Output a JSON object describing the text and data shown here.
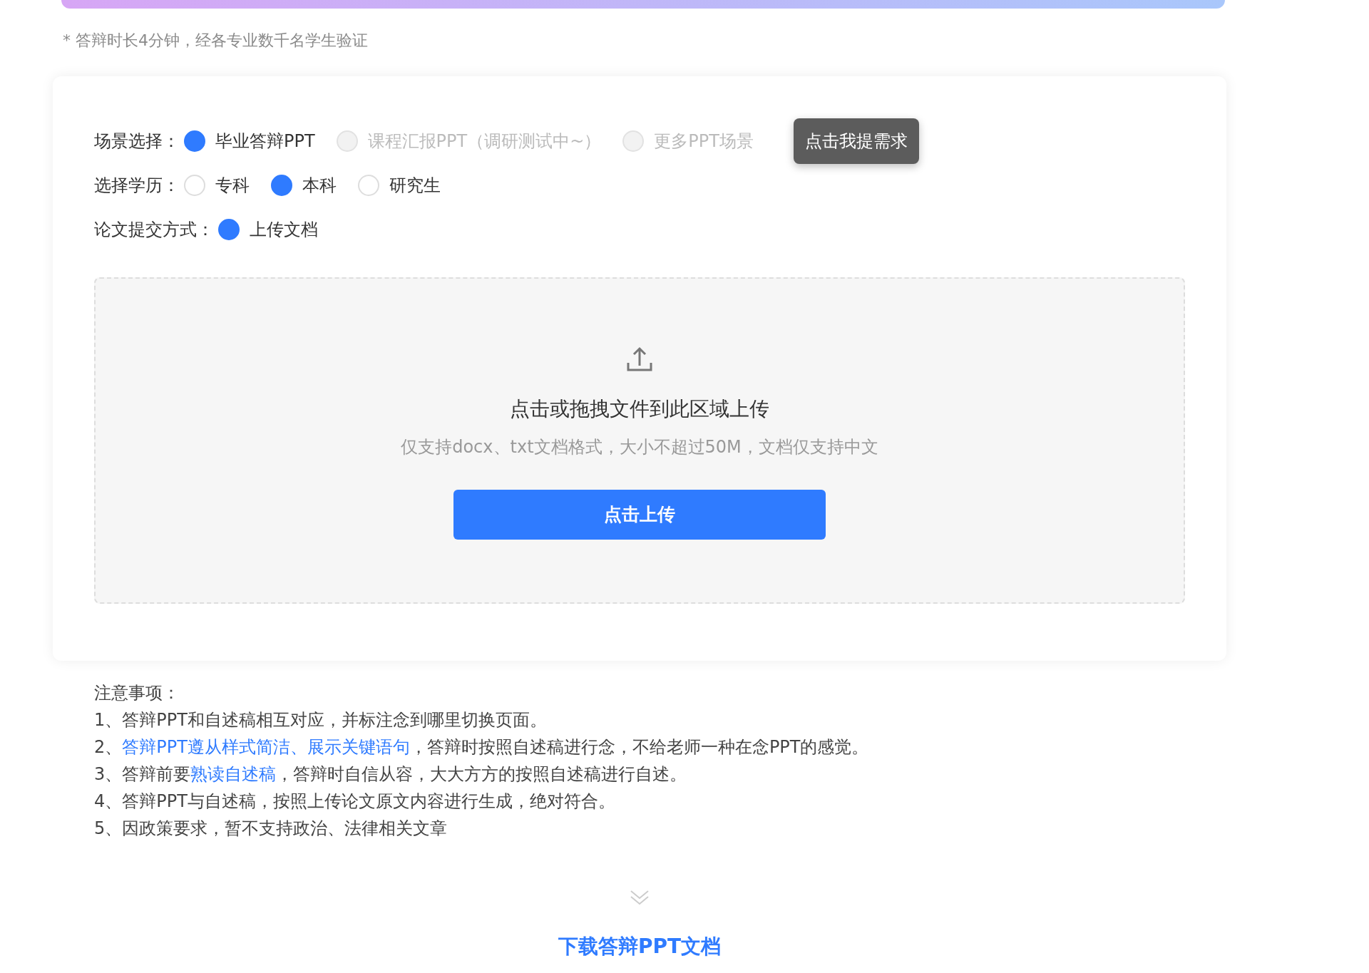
{
  "duration_note": "* 答辩时长4分钟，经各专业数千名学生验证",
  "option_rows": [
    {
      "label": "场景选择：",
      "options": [
        {
          "label": "毕业答辩PPT",
          "selected": true,
          "disabled": false
        },
        {
          "label": "课程汇报PPT（调研测试中~）",
          "selected": false,
          "disabled": true
        },
        {
          "label": "更多PPT场景",
          "selected": false,
          "disabled": true
        }
      ],
      "tooltip": "点击我提需求"
    },
    {
      "label": "选择学历：",
      "options": [
        {
          "label": "专科",
          "selected": false,
          "disabled": false
        },
        {
          "label": "本科",
          "selected": true,
          "disabled": false
        },
        {
          "label": "研究生",
          "selected": false,
          "disabled": false
        }
      ]
    },
    {
      "label": "论文提交方式：",
      "options": [
        {
          "label": "上传文档",
          "selected": true,
          "disabled": false
        }
      ]
    }
  ],
  "upload": {
    "title": "点击或拖拽文件到此区域上传",
    "hint": "仅支持docx、txt文档格式，大小不超过50M，文档仅支持中文",
    "button": "点击上传"
  },
  "notes": {
    "heading": "注意事项：",
    "items": [
      [
        {
          "text": "1、答辩PPT和自述稿相互对应，并标注念到哪里切换页面。",
          "emphasis": false
        }
      ],
      [
        {
          "text": "2、",
          "emphasis": false
        },
        {
          "text": "答辩PPT遵从样式简洁、展示关键语句",
          "emphasis": true
        },
        {
          "text": "，答辩时按照自述稿进行念，不给老师一种在念PPT的感觉。",
          "emphasis": false
        }
      ],
      [
        {
          "text": "3、答辩前要",
          "emphasis": false
        },
        {
          "text": "熟读自述稿",
          "emphasis": true
        },
        {
          "text": "，答辩时自信从容，大大方方的按照自述稿进行自述。",
          "emphasis": false
        }
      ],
      [
        {
          "text": "4、答辩PPT与自述稿，按照上传论文原文内容进行生成，绝对符合。",
          "emphasis": false
        }
      ],
      [
        {
          "text": "5、因政策要求，暂不支持政治、法律相关文章",
          "emphasis": false
        }
      ]
    ]
  },
  "download_link": "下载答辩PPT文档"
}
